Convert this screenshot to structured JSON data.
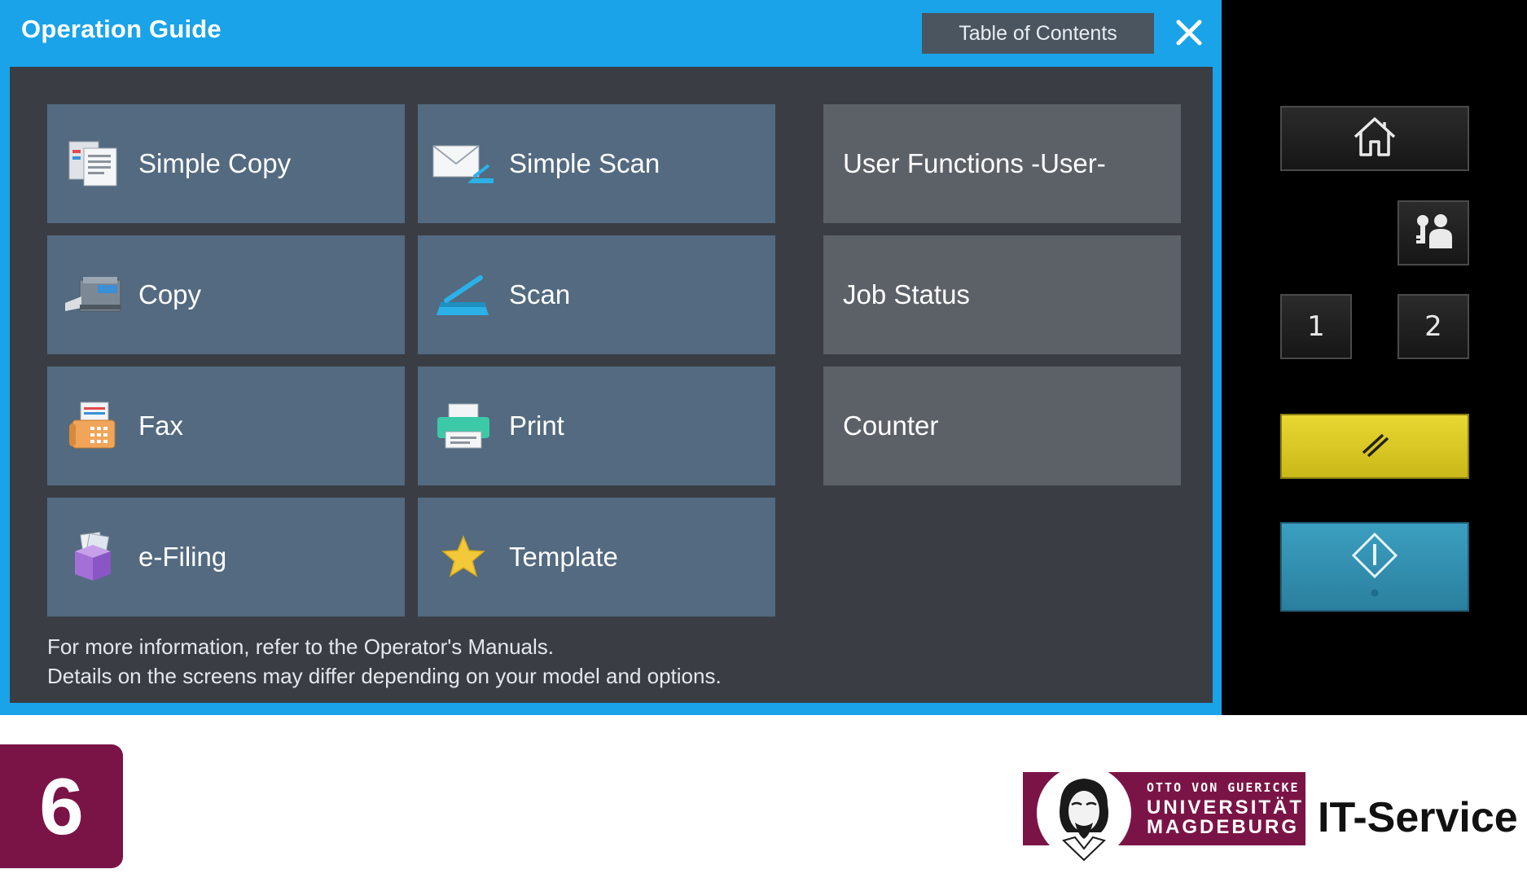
{
  "window": {
    "title": "Operation Guide",
    "toc_label": "Table of Contents",
    "close_icon": "close-icon"
  },
  "tiles": {
    "simple_copy": "Simple Copy",
    "simple_scan": "Simple Scan",
    "copy": "Copy",
    "scan": "Scan",
    "fax": "Fax",
    "print": "Print",
    "efiling": "e-Filing",
    "template": "Template",
    "user_functions": "User Functions -User-",
    "job_status": "Job Status",
    "counter": "Counter"
  },
  "footnote": {
    "line1": "For more information, refer to the Operator's Manuals.",
    "line2": "Details on the screens may differ depending on your model and options."
  },
  "console": {
    "home_icon": "home-icon",
    "user_icon": "user-key-icon",
    "btn1": "1",
    "btn2": "2",
    "reset_icon": "reset-icon",
    "start_icon": "start-icon"
  },
  "branding": {
    "chapter": "6",
    "uni_line1": "OTTO VON GUERICKE",
    "uni_line2": "UNIVERSITÄT",
    "uni_line3": "MAGDEBURG",
    "service": "IT-Service"
  },
  "colors": {
    "title_bar": "#1aa3e8",
    "tile_blue": "#536a80",
    "tile_gray": "#5c6168",
    "content_bg": "#3a3e44",
    "brand": "#7b1446",
    "reset": "#e9d832",
    "start": "#3c9fc0"
  }
}
